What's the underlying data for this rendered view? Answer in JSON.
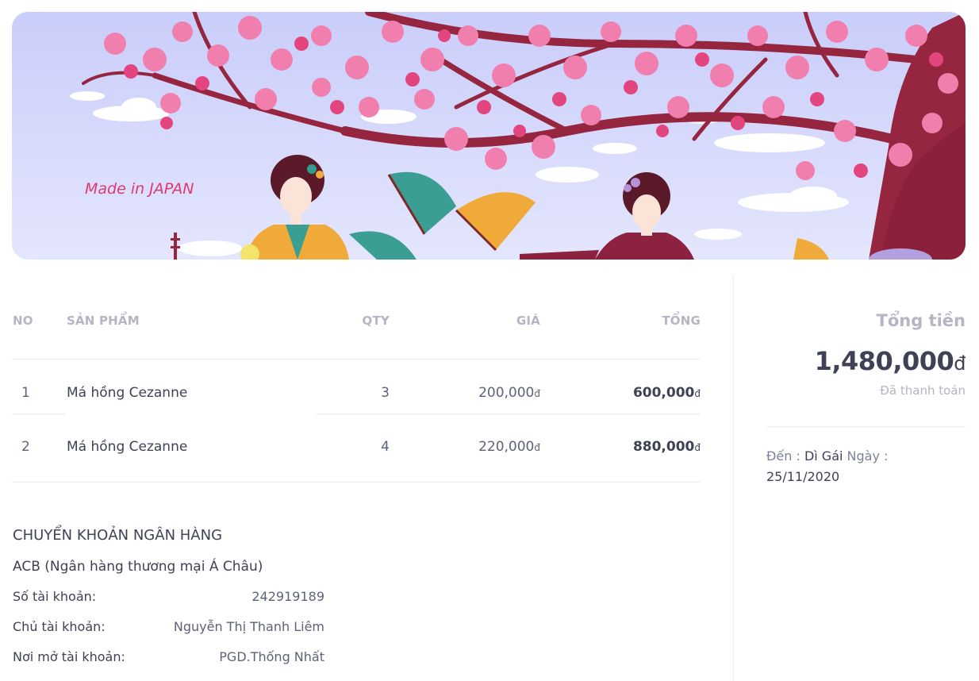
{
  "banner": {
    "made_in_text": "Made in JAPAN",
    "colors": {
      "sky": "#d4d9fb",
      "branch": "#96253f",
      "blossom": "#f07fae",
      "blossom_dark": "#e3467f"
    }
  },
  "table": {
    "headers": {
      "no": "NO",
      "product": "SẢN PHẨM",
      "qty": "QTY",
      "price": "GIÁ",
      "total": "TỔNG"
    },
    "rows": [
      {
        "no": "1",
        "product": "Má hồng Cezanne",
        "qty": "3",
        "price": "200,000",
        "total": "600,000"
      },
      {
        "no": "2",
        "product": "Má hồng Cezanne",
        "qty": "4",
        "price": "220,000",
        "total": "880,000"
      }
    ],
    "currency_symbol": "đ"
  },
  "bank": {
    "title": "CHUYỂN KHOẢN NGÂN HÀNG",
    "bank_name": "ACB (Ngân hàng thương mại Á Châu)",
    "account_number_label": "Số tài khoản:",
    "account_number": "242919189",
    "account_holder_label": "Chủ tài khoản:",
    "account_holder": "Nguyễn Thị Thanh Liêm",
    "branch_label": "Nơi mở tài khoản:",
    "branch": "PGD.Thống Nhất"
  },
  "summary": {
    "total_label": "Tổng tiền",
    "total_amount": "1,480,000",
    "currency_symbol": "đ",
    "status": "Đã thanh toán",
    "to_label": "Đến :",
    "to_name": "Dì Gái",
    "date_label": "Ngày :",
    "date": "25/11/2020"
  }
}
